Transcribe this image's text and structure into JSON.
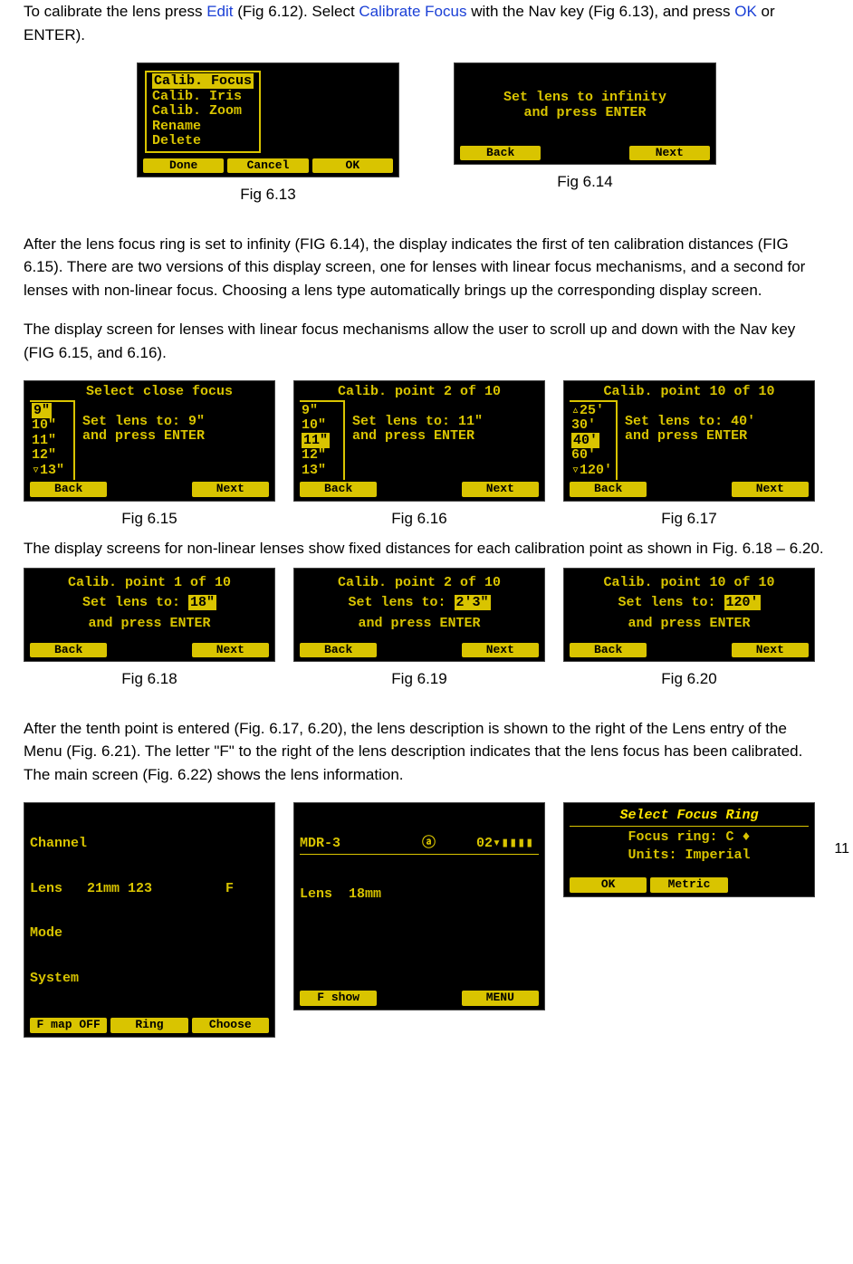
{
  "para1_a": "To calibrate the lens press ",
  "para1_edit": "Edit",
  "para1_b": " (Fig 6.12).  Select ",
  "para1_calib": "Calibrate Focus",
  "para1_c": " with the Nav key (Fig 6.13), and press ",
  "para1_ok": "OK",
  "para1_d": " or ENTER).",
  "fig613": {
    "caption": "Fig 6.13",
    "menu": [
      "Calib. Focus",
      "Calib. Iris",
      "Calib. Zoom",
      "Rename",
      "Delete"
    ],
    "sk": [
      "Done",
      "Cancel",
      "OK"
    ]
  },
  "fig614": {
    "caption": "Fig 6.14",
    "line1": "Set lens to infinity",
    "line2": "and press ENTER",
    "sk": [
      "Back",
      "",
      "Next"
    ]
  },
  "para2": "After the lens focus ring is set to infinity (FIG 6.14), the display indicates the first of ten calibration distances (FIG 6.15). There are two versions of this display screen, one for lenses with linear focus mechanisms, and a second for lenses with non-linear focus. Choosing a lens type automatically brings up the corresponding display screen.",
  "para3": "The display screen for lenses with linear focus mechanisms allow the user to scroll up and down with the Nav key (FIG 6.15, and 6.16).",
  "fig615": {
    "caption": "Fig 6.15",
    "title": "Select close focus",
    "list": [
      "9\"",
      "10\"",
      "11\"",
      "12\"",
      "▿13\""
    ],
    "hl_index": 0,
    "r1": "Set lens to: 9\"",
    "r2": "and press ENTER",
    "sk": [
      "Back",
      "",
      "Next"
    ]
  },
  "fig616": {
    "caption": "Fig 6.16",
    "title": "Calib. point 2  of 10",
    "list": [
      "9\"",
      "10\"",
      "11\"",
      "12\"",
      "13\""
    ],
    "hl_index": 2,
    "r1": "Set lens to: 11\"",
    "r2": "and press ENTER",
    "sk": [
      "Back",
      "",
      "Next"
    ]
  },
  "fig617": {
    "caption": "Fig 6.17",
    "title": "Calib. point 10 of 10",
    "list": [
      "▵25'",
      "30'",
      "40'",
      "60'",
      "▿120'"
    ],
    "hl_index": 2,
    "r1": "Set lens to: 40'",
    "r2": "and press ENTER",
    "sk": [
      "Back",
      "",
      "Next"
    ]
  },
  "para4": "The display screens for non-linear lenses show fixed distances for each calibration point as shown in Fig. 6.18 – 6.20.",
  "fig618": {
    "caption": "Fig 6.18",
    "l1": "Calib. point 1  of 10",
    "l2a": "Set lens to:   ",
    "l2b": "18\"",
    "l3": "and press ENTER",
    "sk": [
      "Back",
      "",
      "Next"
    ]
  },
  "fig619": {
    "caption": "Fig 6.19",
    "l1": "Calib. point 2  of 10",
    "l2a": "Set lens to:   ",
    "l2b": "2'3\"",
    "l3": "and press ENTER",
    "sk": [
      "Back",
      "",
      "Next"
    ]
  },
  "fig620": {
    "caption": "Fig 6.20",
    "l1": "Calib. point 10 of 10",
    "l2a": "Set lens to:   ",
    "l2b": "120'",
    "l3": "and press ENTER",
    "sk": [
      "Back",
      "",
      "Next"
    ]
  },
  "para5": "After the tenth point is entered (Fig. 6.17, 6.20), the lens description is shown to the right of the Lens entry of the Menu (Fig. 6.21). The letter \"F\" to the right of the lens description indicates that the lens focus has been calibrated.  The main screen (Fig. 6.22) shows the lens information.",
  "fig621": {
    "lines": [
      "Channel",
      "Lens   21mm 123         F",
      "Mode",
      "System"
    ],
    "sk": [
      "F map OFF",
      "Ring",
      "Choose"
    ]
  },
  "fig622": {
    "top": "MDR-3          ⓐ     02▾▮▮▮▮",
    "line": "Lens  18mm",
    "sk": [
      "F show",
      "",
      "MENU"
    ]
  },
  "fig623": {
    "title": "Select Focus Ring",
    "l1": "Focus ring:  C ♦",
    "l2": "Units: Imperial",
    "sk": [
      "OK",
      "Metric",
      ""
    ]
  },
  "page_number": "11"
}
